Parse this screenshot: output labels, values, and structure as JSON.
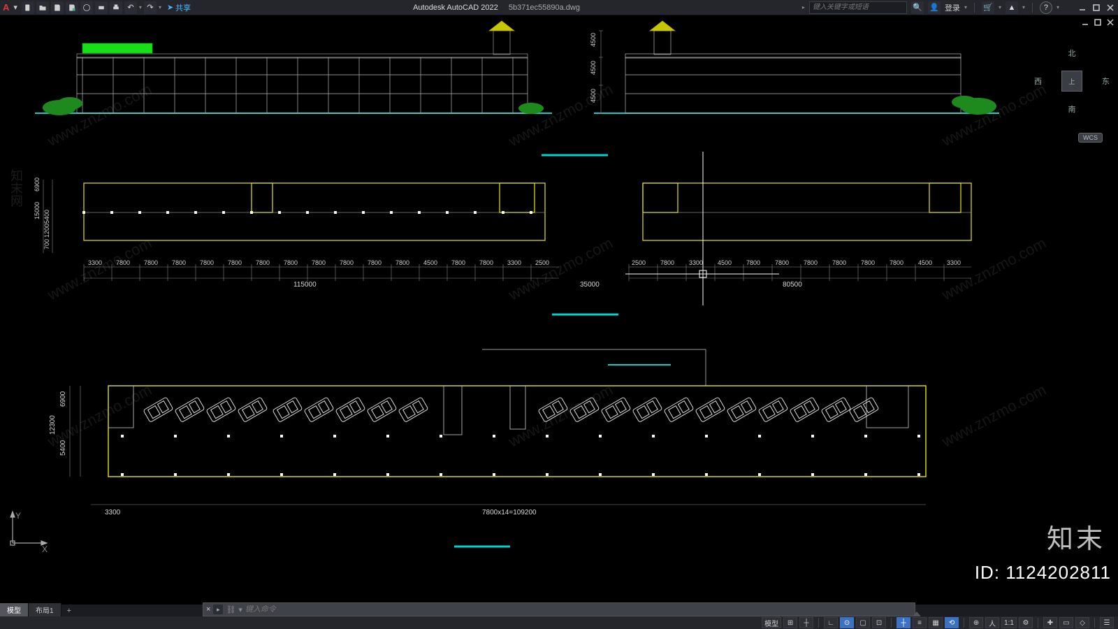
{
  "app": {
    "name": "Autodesk AutoCAD 2022",
    "file": "5b371ec55890a.dwg",
    "logo": "A"
  },
  "qa": {
    "new": "☰",
    "open": "📄",
    "save": "💾",
    "saveas": "💾",
    "plot": "📋",
    "print": "🖨",
    "undo": "↶",
    "redo": "↷"
  },
  "share": {
    "icon": "➤",
    "label": "共享"
  },
  "search": {
    "placeholder": "键入关键字或短语",
    "icon": "🔍"
  },
  "account": {
    "icon": "👤",
    "label": "登录"
  },
  "topright": {
    "cart": "🛒",
    "apps": "▲",
    "help": "?"
  },
  "window": {
    "min": "—",
    "max": "▢",
    "close": "✕",
    "min2": "—",
    "max2": "▢",
    "close2": "✕"
  },
  "viewcube": {
    "n": "北",
    "s": "南",
    "e": "东",
    "w": "西",
    "top": "上",
    "wcs": "WCS"
  },
  "axes": {
    "x": "X",
    "y": "Y"
  },
  "cmd": {
    "placeholder": "键入命令",
    "x": "×",
    "chev": "▸",
    "chain": "⛓"
  },
  "tabs": {
    "model": "模型",
    "layout1": "布局1",
    "plus": "+"
  },
  "status": {
    "model": "模型",
    "grid": "⊞",
    "snap": "┼",
    "ortho": "∟",
    "polar": "⊙",
    "osnap": "▢",
    "los": "⊡",
    "dyn": "┼",
    "lw": "≡",
    "trans": "▦",
    "cyc": "⟲",
    "ann": "⊕",
    "a1": "人",
    "a2": "1:1",
    "gear": "⚙",
    "dec": "✚",
    "box": "▭",
    "iso": "◇",
    "clean": "☰"
  },
  "dims": {
    "elev_v": [
      "4500",
      "4500",
      "4500"
    ],
    "plan1_v": [
      "700",
      "1200",
      "5400",
      "15000",
      "6900"
    ],
    "plan1_h_a": [
      "3300",
      "7800",
      "7800",
      "7800",
      "7800",
      "7800",
      "7800",
      "7800",
      "7800",
      "7800",
      "7800",
      "7800",
      "4500",
      "7800",
      "7800",
      "3300",
      "2500"
    ],
    "plan1_total_a": "115000",
    "plan1_gap": "35000",
    "plan1_h_b": [
      "2500",
      "7800",
      "3300",
      "4500",
      "7800",
      "7800",
      "7800",
      "7800",
      "7800",
      "7800",
      "4500",
      "3300"
    ],
    "plan1_total_b": "80500",
    "plan2_v": [
      "5400",
      "6900",
      "12300"
    ],
    "plan2_h_left": "3300",
    "plan2_total": "7800x14=109200"
  },
  "watermark": {
    "text": "www.znzmo.com",
    "brand": "知末",
    "net": "知末网",
    "id": "ID: 1124202811"
  }
}
